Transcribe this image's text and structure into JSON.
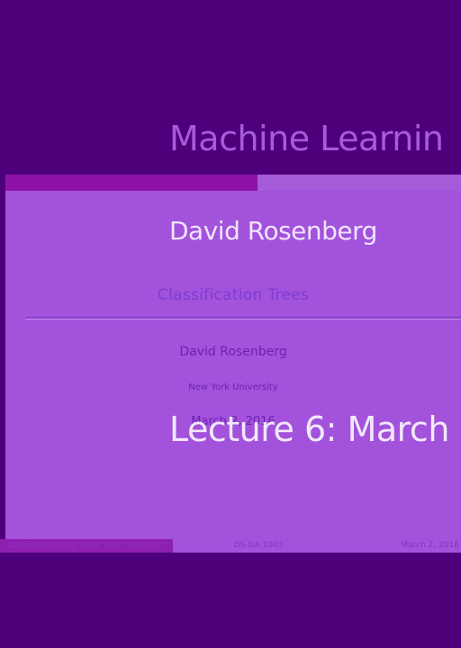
{
  "overlay": {
    "title": "Machine Learnin",
    "name": "David Rosenberg",
    "lecture": "Lecture 6:  March"
  },
  "slide": {
    "title": "Classification  Trees",
    "author": "David Rosenberg",
    "institution": "New York University",
    "date": "March 2, 2016"
  },
  "footer": {
    "left": "David Rosenberg  (New York University)",
    "center": "DS-GA 1003",
    "right": "March 2, 2016"
  },
  "colors": {
    "background": "#4e007a",
    "slide": "#a352dc",
    "accent": "#8c12a6",
    "overlay_text": "#f1e8fb"
  }
}
